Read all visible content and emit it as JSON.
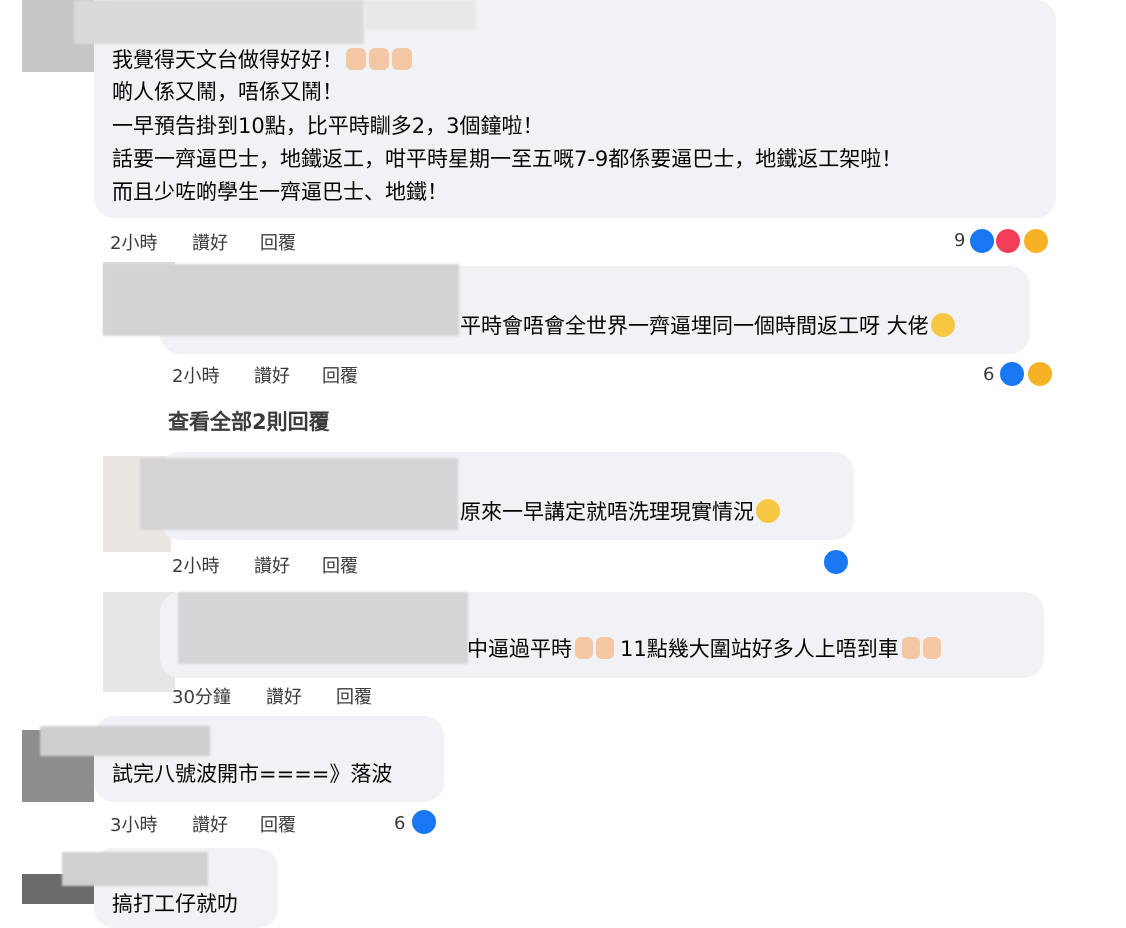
{
  "comments": [
    {
      "lines": [
        "我覺得天文台做得好好！",
        "啲人係又鬧，唔係又鬧！",
        "一早預告掛到10點，比平時瞓多2，3個鐘啦！",
        "話要一齊逼巴士，地鐵返工，咁平時星期一至五嘅7-9都係要逼巴士，地鐵返工架啦！",
        "而且少咗啲學生一齊逼巴士、地鐵！"
      ],
      "time": "2小時",
      "like_label": "讚好",
      "reply_label": "回覆",
      "reaction_count": "9"
    },
    {
      "text": "平時會唔會全世界一齊逼埋同一個時間返工呀 大佬",
      "time": "2小時",
      "like_label": "讚好",
      "reply_label": "回覆",
      "reaction_count": "6",
      "view_replies": "查看全部2則回覆"
    },
    {
      "text": "原來一早講定就唔洗理現實情況",
      "time": "2小時",
      "like_label": "讚好",
      "reply_label": "回覆"
    },
    {
      "text_a": "中逼過平時",
      "text_b": "11點幾大圍站好多人上唔到車",
      "time": "30分鐘",
      "like_label": "讚好",
      "reply_label": "回覆"
    },
    {
      "text": "試完八號波開市====》落波",
      "time": "3小時",
      "like_label": "讚好",
      "reply_label": "回覆",
      "reaction_count": "6"
    },
    {
      "text": "搞打工仔就叻"
    }
  ],
  "colors": {
    "bubble": "#f0f2f5",
    "like": "#1877f2",
    "love": "#f33e58",
    "care": "#f7b125"
  }
}
